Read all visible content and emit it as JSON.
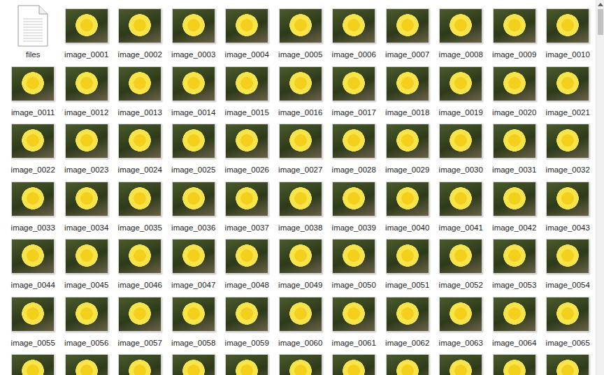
{
  "items": [
    {
      "label": "files",
      "kind": "file"
    },
    {
      "label": "image_0001",
      "kind": "image"
    },
    {
      "label": "image_0002",
      "kind": "image"
    },
    {
      "label": "image_0003",
      "kind": "image"
    },
    {
      "label": "image_0004",
      "kind": "image"
    },
    {
      "label": "image_0005",
      "kind": "image"
    },
    {
      "label": "image_0006",
      "kind": "image"
    },
    {
      "label": "image_0007",
      "kind": "image"
    },
    {
      "label": "image_0008",
      "kind": "image"
    },
    {
      "label": "image_0009",
      "kind": "image"
    },
    {
      "label": "image_0010",
      "kind": "image"
    },
    {
      "label": "image_0011",
      "kind": "image"
    },
    {
      "label": "image_0012",
      "kind": "image"
    },
    {
      "label": "image_0013",
      "kind": "image"
    },
    {
      "label": "image_0014",
      "kind": "image"
    },
    {
      "label": "image_0015",
      "kind": "image"
    },
    {
      "label": "image_0016",
      "kind": "image"
    },
    {
      "label": "image_0017",
      "kind": "image"
    },
    {
      "label": "image_0018",
      "kind": "image"
    },
    {
      "label": "image_0019",
      "kind": "image"
    },
    {
      "label": "image_0020",
      "kind": "image"
    },
    {
      "label": "image_0021",
      "kind": "image"
    },
    {
      "label": "image_0022",
      "kind": "image"
    },
    {
      "label": "image_0023",
      "kind": "image"
    },
    {
      "label": "image_0024",
      "kind": "image"
    },
    {
      "label": "image_0025",
      "kind": "image"
    },
    {
      "label": "image_0026",
      "kind": "image"
    },
    {
      "label": "image_0027",
      "kind": "image"
    },
    {
      "label": "image_0028",
      "kind": "image"
    },
    {
      "label": "image_0029",
      "kind": "image"
    },
    {
      "label": "image_0030",
      "kind": "image"
    },
    {
      "label": "image_0031",
      "kind": "image"
    },
    {
      "label": "image_0032",
      "kind": "image"
    },
    {
      "label": "image_0033",
      "kind": "image"
    },
    {
      "label": "image_0034",
      "kind": "image"
    },
    {
      "label": "image_0035",
      "kind": "image"
    },
    {
      "label": "image_0036",
      "kind": "image"
    },
    {
      "label": "image_0037",
      "kind": "image"
    },
    {
      "label": "image_0038",
      "kind": "image"
    },
    {
      "label": "image_0039",
      "kind": "image"
    },
    {
      "label": "image_0040",
      "kind": "image"
    },
    {
      "label": "image_0041",
      "kind": "image"
    },
    {
      "label": "image_0042",
      "kind": "image"
    },
    {
      "label": "image_0043",
      "kind": "image"
    },
    {
      "label": "image_0044",
      "kind": "image"
    },
    {
      "label": "image_0045",
      "kind": "image"
    },
    {
      "label": "image_0046",
      "kind": "image"
    },
    {
      "label": "image_0047",
      "kind": "image"
    },
    {
      "label": "image_0048",
      "kind": "image"
    },
    {
      "label": "image_0049",
      "kind": "image"
    },
    {
      "label": "image_0050",
      "kind": "image"
    },
    {
      "label": "image_0051",
      "kind": "image"
    },
    {
      "label": "image_0052",
      "kind": "image"
    },
    {
      "label": "image_0053",
      "kind": "image"
    },
    {
      "label": "image_0054",
      "kind": "image"
    },
    {
      "label": "image_0055",
      "kind": "image"
    },
    {
      "label": "image_0056",
      "kind": "image"
    },
    {
      "label": "image_0057",
      "kind": "image"
    },
    {
      "label": "image_0058",
      "kind": "image"
    },
    {
      "label": "image_0059",
      "kind": "image"
    },
    {
      "label": "image_0060",
      "kind": "image"
    },
    {
      "label": "image_0061",
      "kind": "image"
    },
    {
      "label": "image_0062",
      "kind": "image"
    },
    {
      "label": "image_0063",
      "kind": "image"
    },
    {
      "label": "image_0064",
      "kind": "image"
    },
    {
      "label": "image_0065",
      "kind": "image"
    },
    {
      "label": "",
      "kind": "image"
    },
    {
      "label": "",
      "kind": "image"
    },
    {
      "label": "",
      "kind": "image"
    },
    {
      "label": "",
      "kind": "image"
    },
    {
      "label": "",
      "kind": "image"
    },
    {
      "label": "",
      "kind": "image"
    },
    {
      "label": "",
      "kind": "image"
    },
    {
      "label": "",
      "kind": "image"
    },
    {
      "label": "",
      "kind": "image"
    },
    {
      "label": "",
      "kind": "image"
    },
    {
      "label": "",
      "kind": "image"
    }
  ],
  "scrollbar": {
    "level": 0.07
  }
}
